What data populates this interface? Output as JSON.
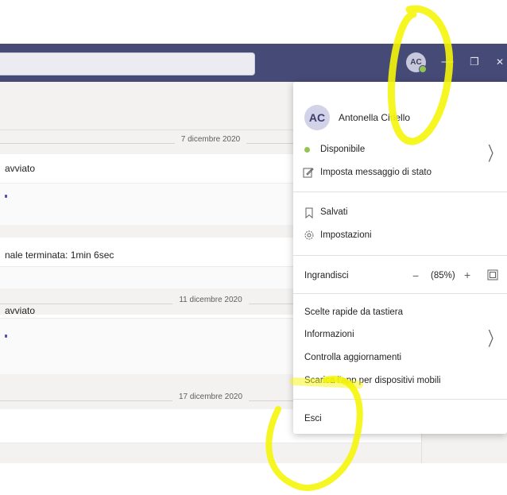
{
  "profile": {
    "initials": "AC",
    "name": "Antonella Ciriello"
  },
  "titlebar": {
    "avatar_initials": "AC",
    "minimize": "—",
    "maximize": "❐",
    "close": "✕"
  },
  "chat": {
    "dates": [
      "7 dicembre 2020",
      "11 dicembre 2020",
      "17 dicembre 2020"
    ],
    "messages": [
      "avviato",
      "nale terminata: 1min 6sec",
      "avviato"
    ]
  },
  "menu": {
    "status": "Disponibile",
    "set_status_message": "Imposta messaggio di stato",
    "saved": "Salvati",
    "settings": "Impostazioni",
    "zoom_label": "Ingrandisci",
    "zoom_minus": "−",
    "zoom_value": "(85%)",
    "zoom_plus": "+",
    "shortcuts": "Scelte rapide da tastiera",
    "info": "Informazioni",
    "check_updates": "Controlla aggiornamenti",
    "download_mobile": "Scarica l'app per dispositivi mobili",
    "sign_out": "Esci"
  },
  "colors": {
    "titlebar": "#454a77",
    "status_available": "#92c353",
    "highlight": "#f5f50a"
  },
  "icons": [
    "status-available-icon",
    "edit-status-icon",
    "bookmark-icon",
    "gear-icon",
    "fit-screen-icon",
    "chevron-right-icon"
  ]
}
